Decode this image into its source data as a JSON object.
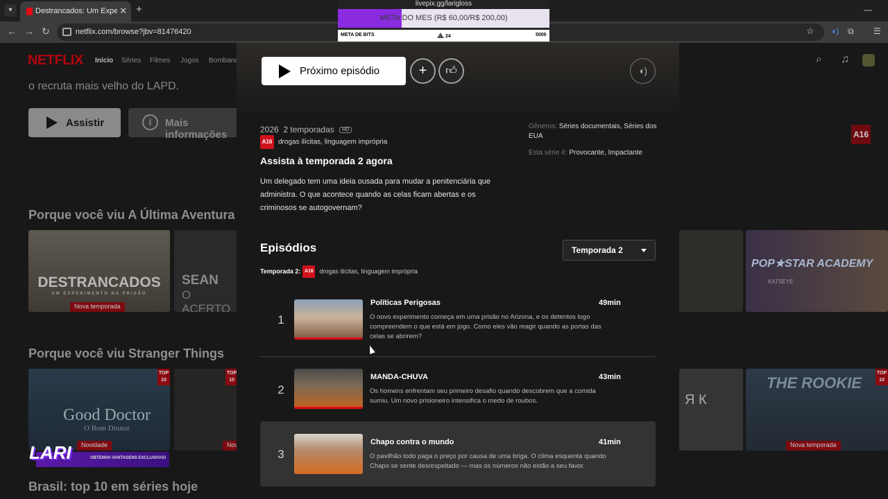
{
  "browser": {
    "tab_title": "Destrancados: Um Experimento",
    "tab_close": "✕",
    "new_tab": "+",
    "url": "netflix.com/browse?jbv=81476420"
  },
  "stream_overlay": {
    "top_text": "livepix.gg/larigloss",
    "goal_text": "META DO MES (R$ 60,00/R$ 200,00)",
    "goal_progress": 0.3,
    "bits_label": "META DE BITS",
    "bits_current": "24",
    "bits_target": "5000",
    "lari_logo": "LARI",
    "lari_sub": "OBTENHA VANTAGENS EXCLUSIVAS!"
  },
  "netflix": {
    "logo": "NETFLIX",
    "nav": [
      "Início",
      "Séries",
      "Filmes",
      "Jogos",
      "Bombando"
    ],
    "hero_text": "o recruta mais velho do LAPD.",
    "hero_play": "Assistir",
    "hero_info": "Mais informações",
    "rows": [
      {
        "title": "Porque você viu A Última Aventura"
      },
      {
        "title": "Porque você viu Stranger Things"
      },
      {
        "title": "Brasil: top 10 em séries hoje"
      }
    ],
    "thumbs": {
      "destrancados_title": "DESTRANCADOS",
      "destrancados_sub": "UM EXPERIMENTO NA PRISÃO",
      "new_season": "Nova temporada",
      "sean_title": "SEAN",
      "sean_sub": "O ACERTO",
      "pop_title": "POP★STAR ACADEMY",
      "pop_sub": "KATSEYE",
      "good_doctor": "Good Doctor",
      "good_doctor_sub": "O Bom Doutor",
      "novidade": "Novidade",
      "rookie": "THE ROOKIE",
      "nova_temporada": "Nova temporada",
      "ya": "Я  К",
      "top10": "TOP 10",
      "a16": "A16"
    }
  },
  "modal": {
    "next_episode": "Próximo episódio",
    "year": "2026",
    "seasons": "2 temporadas",
    "hd": "HD",
    "rating": "A16",
    "rating_reasons": "drogas ilícitas, linguagem imprópria",
    "watch_title": "Assista à temporada 2 agora",
    "synopsis": "Um delegado tem uma ideia ousada para mudar a penitenciária que administra. O que acontece quando as celas ficam abertas e os criminosos se autogovernam?",
    "genres_label": "Gêneros:",
    "genres": "Séries documentais, Séries dos EUA",
    "mood_label": "Esta série é:",
    "mood": "Provocante, Impactante",
    "episodes_heading": "Episódios",
    "season_select": "Temporada 2",
    "season_rating_label": "Temporada 2:",
    "episodes": [
      {
        "num": "1",
        "title": "Políticas Perigosas",
        "duration": "49min",
        "description": "O novo experimento começa em uma prisão no Arizona, e os detentos logo compreendem o que está em jogo. Como eles vão reagir quando as portas das celas se abrirem?",
        "watched": true
      },
      {
        "num": "2",
        "title": "MANDA-CHUVA",
        "duration": "43min",
        "description": "Os homens enfrentam seu primeiro desafio quando descobrem que a comida sumiu. Um novo prisioneiro intensifica o medo de roubos.",
        "watched": true
      },
      {
        "num": "3",
        "title": "Chapo contra o mundo",
        "duration": "41min",
        "description": "O pavilhão todo paga o preço por causa de uma briga. O clima esquenta quando Chapo se sente desrespeitado — mas os números não estão a seu favor.",
        "watched": false
      }
    ]
  }
}
